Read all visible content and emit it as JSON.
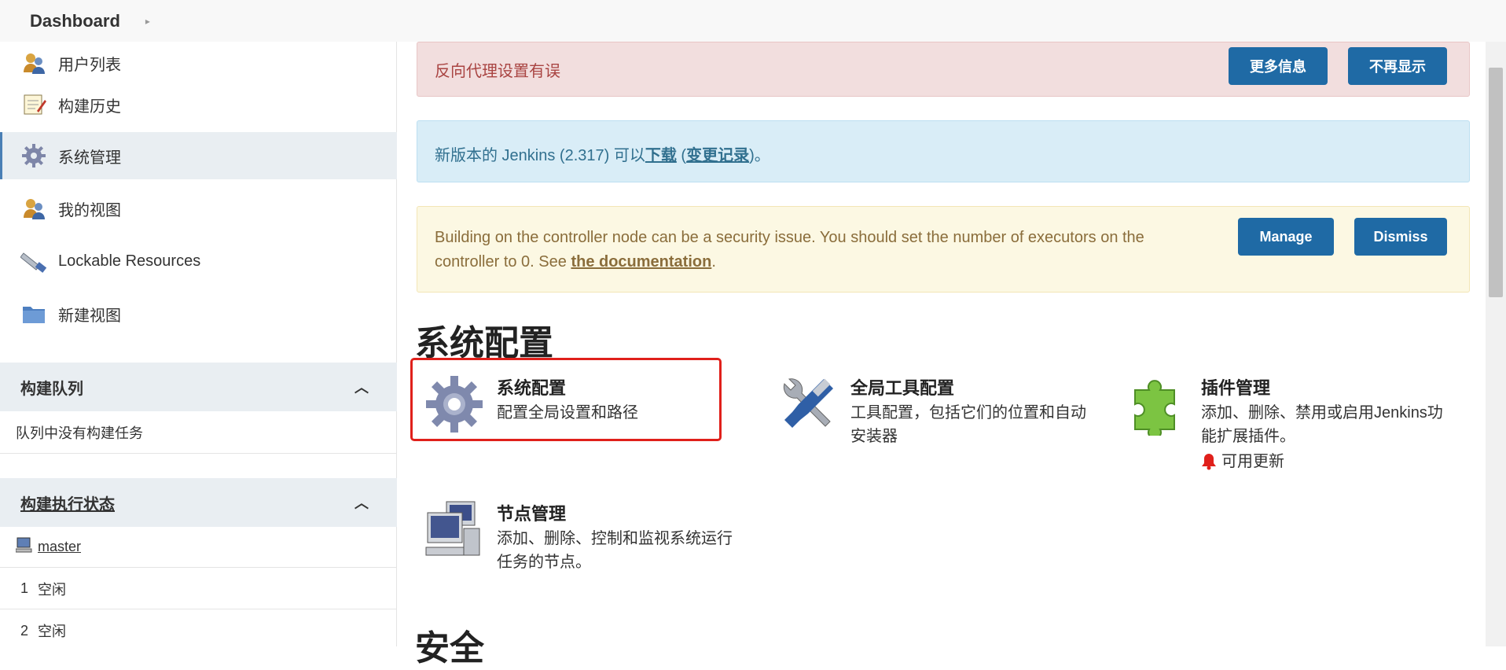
{
  "breadcrumb": {
    "root": "Dashboard"
  },
  "sidebar": {
    "items": [
      {
        "label": "用户列表",
        "icon": "users-icon"
      },
      {
        "label": "构建历史",
        "icon": "notepad-icon"
      },
      {
        "label": "系统管理",
        "icon": "gear-icon",
        "active": true
      },
      {
        "label": "我的视图",
        "icon": "users-icon"
      },
      {
        "label": "Lockable Resources",
        "icon": "usb-icon"
      },
      {
        "label": "新建视图",
        "icon": "folder-icon"
      }
    ],
    "build_queue": {
      "title": "构建队列",
      "empty_text": "队列中没有构建任务"
    },
    "executors": {
      "title": "构建执行状态",
      "node": "master",
      "rows": [
        {
          "num": "1",
          "state": "空闲"
        },
        {
          "num": "2",
          "state": "空闲"
        }
      ]
    }
  },
  "alerts": {
    "proxy": {
      "text": "反向代理设置有误",
      "more_info": "更多信息",
      "dismiss": "不再显示"
    },
    "update": {
      "prefix": "新版本的 Jenkins (2.317) 可以",
      "download": "下载",
      "open_paren": " (",
      "changelog": "变更记录",
      "suffix": ")。"
    },
    "security": {
      "text_line1": "Building on the controller node can be a security issue. You should set the number of executors on the",
      "text_line2": "controller to 0. See ",
      "link": "the documentation",
      "period": ".",
      "manage": "Manage",
      "dismiss": "Dismiss"
    }
  },
  "sections": {
    "system_config": "系统配置",
    "security": "安全"
  },
  "tiles": {
    "configure": {
      "title": "系统配置",
      "desc": "配置全局设置和路径"
    },
    "tools": {
      "title": "全局工具配置",
      "desc1": "工具配置，包括它们的位置和自动",
      "desc2": "安装器"
    },
    "plugins": {
      "title": "插件管理",
      "desc1": "添加、删除、禁用或启用Jenkins功",
      "desc2": "能扩展插件。",
      "update": "可用更新"
    },
    "nodes": {
      "title": "节点管理",
      "desc1": "添加、删除、控制和监视系统运行",
      "desc2": "任务的节点。"
    }
  },
  "colors": {
    "accent_button": "#1f6aa5",
    "highlight": "#e0201b"
  }
}
